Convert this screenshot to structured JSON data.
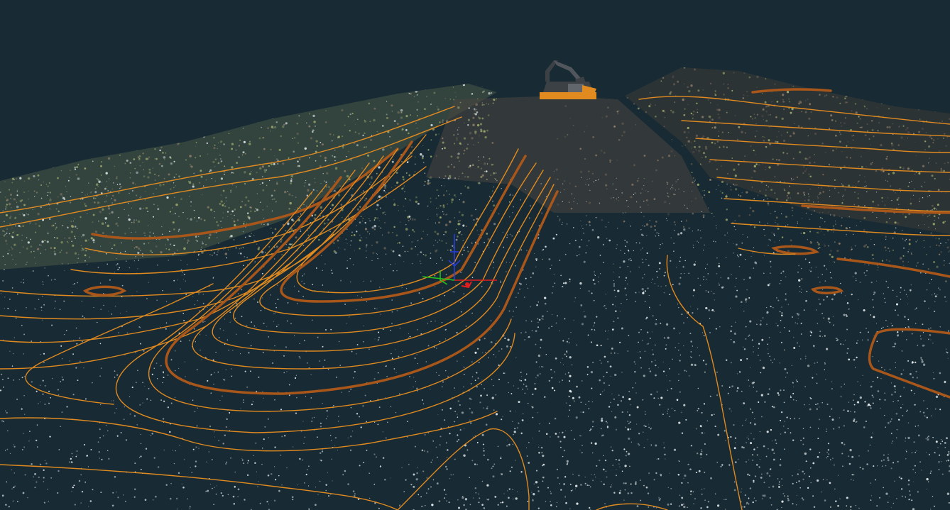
{
  "app": {
    "kind": "3d-point-cloud-viewer",
    "view": "perspective"
  },
  "scene": {
    "background_color": "#182a33",
    "point_cloud": {
      "colors": {
        "ground_points": "#dfe7ea",
        "vegetation": "#9aa56a",
        "bare_soil": "#8a7a66",
        "dark_soil": "#5c544c"
      }
    },
    "contours": {
      "minor_color": "#e08a20",
      "major_color": "#a8561a"
    },
    "excavator": {
      "icon": "excavator-icon",
      "body_color": "#3c4146",
      "accent_color": "#e08a20"
    },
    "gizmo": {
      "icon": "axis-gizmo-icon",
      "x_axis_color": "#e01e1e",
      "y_axis_color": "#1ec81e",
      "z_axis_color": "#2840e0"
    }
  }
}
